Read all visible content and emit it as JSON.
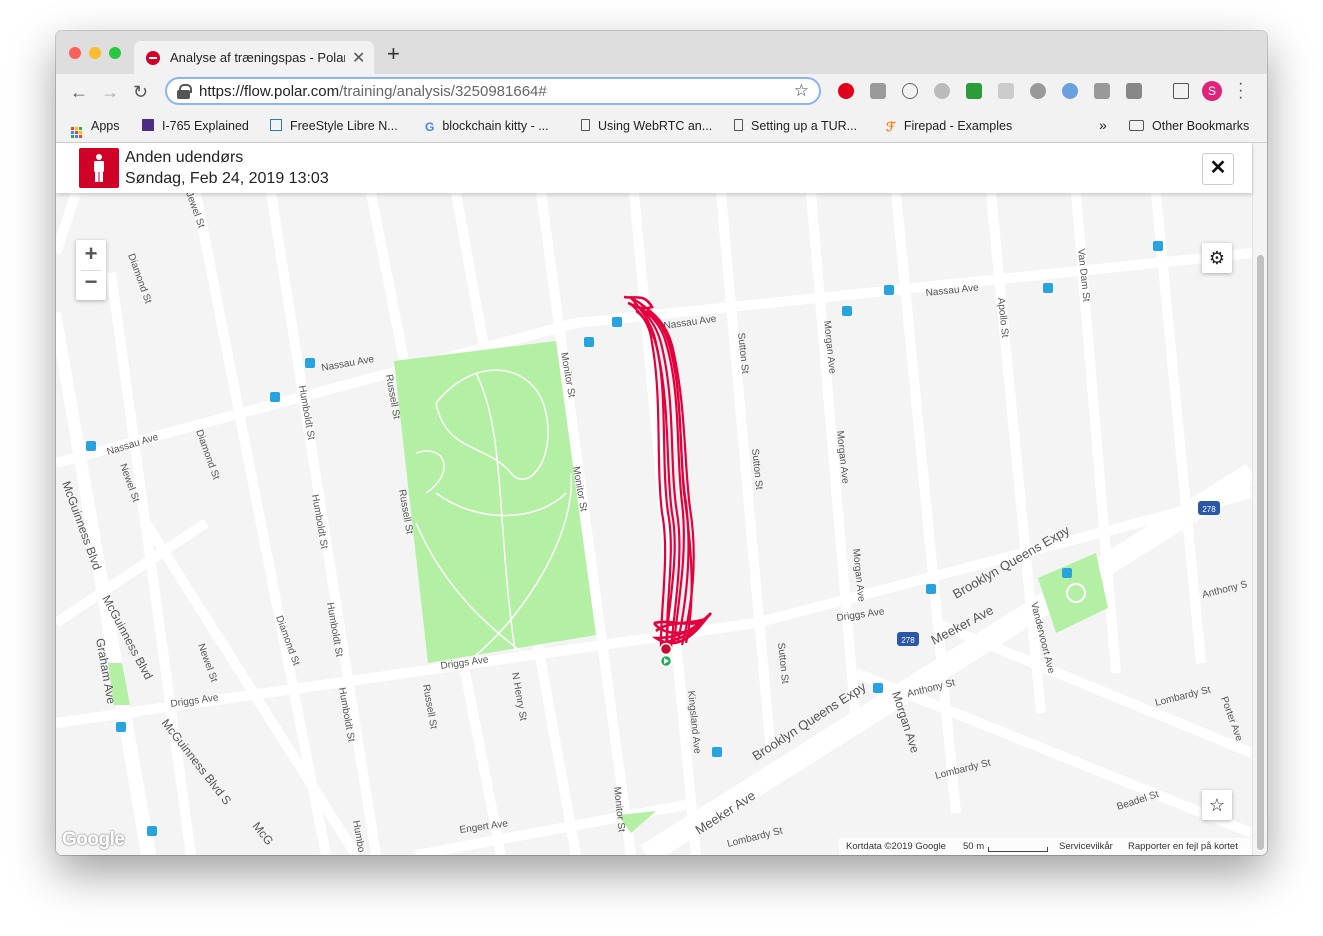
{
  "browser": {
    "tab_title": "Analyse af træningspas - Polar",
    "tab_close": "✕",
    "new_tab": "+",
    "url_host": "https://flow.polar.com",
    "url_path": "/training/analysis/3250981664#",
    "profile_initial": "S",
    "bookmarks": [
      "Apps",
      "I-765 Explained",
      "FreeStyle Libre N...",
      "blockchain kitty - ...",
      "Using WebRTC an...",
      "Setting up a TUR...",
      "Firepad - Examples"
    ],
    "overflow": "»",
    "other_bookmarks": "Other Bookmarks"
  },
  "page": {
    "title": "Anden udendørs",
    "date": "Søndag, Feb 24, 2019 13:03",
    "close": "✕"
  },
  "map": {
    "zoom_in": "+",
    "zoom_out": "−",
    "google": "Google",
    "attribution": "Kortdata ©2019 Google",
    "scale": "50 m",
    "terms": "Servicevilkår",
    "report": "Rapporter en fejl på kortet",
    "streets": {
      "nassau_1": "Nassau Ave",
      "nassau_2": "Nassau Ave",
      "nassau_3": "Nassau Ave",
      "nassau_4": "Nassau Ave",
      "monitor_1": "Monitor St",
      "monitor_2": "Monitor St",
      "monitor_3": "Monitor St",
      "russell_1": "Russell St",
      "russell_2": "Russell St",
      "russell_3": "Russell St",
      "humboldt_1": "Humboldt St",
      "humboldt_2": "Humboldt St",
      "humboldt_3": "Humboldt St",
      "humboldt_4": "Humboldt St",
      "humboldt_5": "Humbo",
      "diamond_1": "Diamond St",
      "diamond_2": "Diamond St",
      "diamond_3": "Diamond St",
      "newel_1": "Newel St",
      "newel_2": "Newel St",
      "mcguinness_1": "McGuinness Blvd",
      "mcguinness_2": "McGuinness Blvd",
      "mcguinness_s": "McGuinness Blvd S",
      "mcg": "McG",
      "graham": "Graham Ave",
      "driggs_1": "Driggs Ave",
      "driggs_2": "Driggs Ave",
      "driggs_3": "Driggs Ave",
      "n_henry": "N Henry St",
      "sutton_1": "Sutton St",
      "sutton_2": "Sutton St",
      "sutton_3": "Sutton St",
      "morgan_1": "Morgan Ave",
      "morgan_2": "Morgan Ave",
      "morgan_3": "Morgan Ave",
      "morgan_4": "Morgan Ave",
      "apollo": "Apollo St",
      "van_dam": "Van Dam St",
      "bqe_1": "Brooklyn Queens Expy",
      "bqe_2": "Brooklyn Queens Expy",
      "meeker_1": "Meeker Ave",
      "meeker_2": "Meeker Ave",
      "vandervoort": "Vandervoort Ave",
      "anthony_1": "Anthony S",
      "anthony_2": "Anthony St",
      "lombardy_1": "Lombardy St",
      "lombardy_2": "Lombardy St",
      "lombardy_3": "Lombardy St",
      "porter": "Porter Ave",
      "beadel": "Beadel St",
      "kingsland": "Kingsland Ave",
      "engert": "Engert Ave",
      "jewel": "Jewel St",
      "shield_278": "278",
      "shield_278b": "278"
    }
  },
  "colors": {
    "route": "#e4003c",
    "park": "#b4f0a4",
    "polar_red": "#d10027"
  }
}
